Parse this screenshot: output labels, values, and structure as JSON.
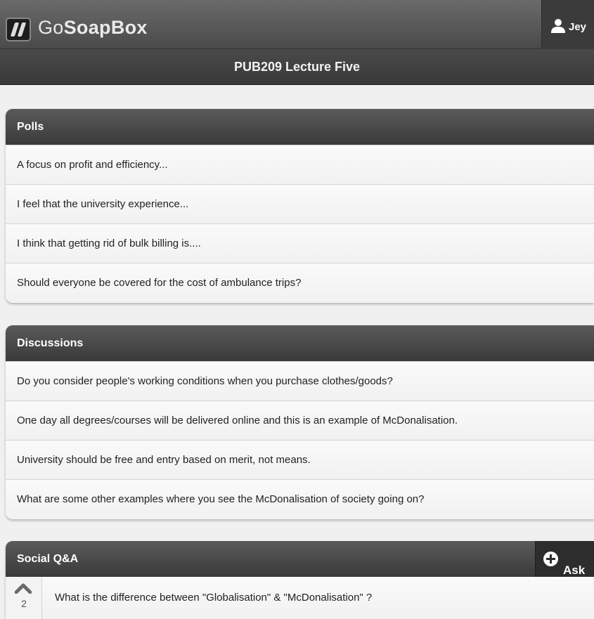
{
  "header": {
    "brand_prefix": "Go",
    "brand_bold": "SoapBox",
    "user_name": "Jey"
  },
  "lecture": {
    "title": "PUB209 Lecture Five"
  },
  "polls": {
    "title": "Polls",
    "items": [
      "A focus on profit and efficiency...",
      "I feel that the university experience...",
      "I think that getting rid of bulk billing is....",
      "Should everyone be covered for the cost of ambulance trips?"
    ]
  },
  "discussions": {
    "title": "Discussions",
    "items": [
      "Do you consider people's working conditions when you purchase clothes/goods?",
      "One day all degrees/courses will be delivered online and this is an example of McDonalisation.",
      "University should be free and entry based on merit, not means.",
      "What are some other examples where you see the McDonalisation of society going on?"
    ]
  },
  "social_qa": {
    "title": "Social Q&A",
    "ask_label": "Ask",
    "questions": [
      {
        "votes": "2",
        "text": "What is the difference between \"Globalisation\" & \"McDonalisation\" ?"
      }
    ]
  },
  "icons": {
    "logo": "gosoapbox-logo",
    "user": "user-icon",
    "ask": "plus-circle-icon",
    "vote": "upvote-chevron-icon"
  }
}
